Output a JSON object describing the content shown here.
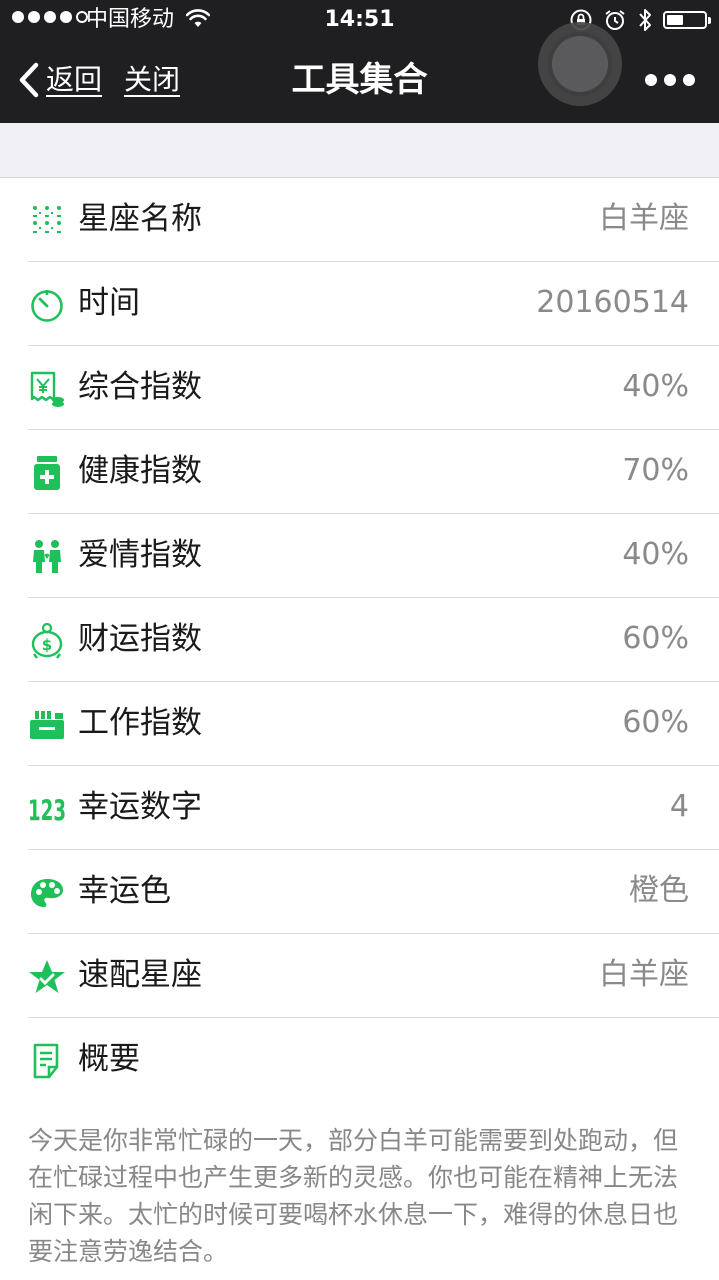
{
  "status_bar": {
    "carrier": "中国移动",
    "time": "14:51",
    "signal_bars_filled": 4,
    "signal_bars_total": 5,
    "battery_level": 0.45,
    "icons": [
      "wifi-icon",
      "orientation-lock-icon",
      "alarm-icon",
      "bluetooth-icon",
      "battery-icon"
    ]
  },
  "nav": {
    "back_label": "返回",
    "close_label": "关闭",
    "title": "工具集合",
    "more_icon": "more-icon"
  },
  "accent_color": "#1fbf5a",
  "rows": [
    {
      "key": "constellation",
      "icon": "zodiac-grid-icon",
      "label": "星座名称",
      "value": "白羊座"
    },
    {
      "key": "time",
      "icon": "timer-icon",
      "label": "时间",
      "value": "20160514"
    },
    {
      "key": "overall",
      "icon": "receipt-icon",
      "label": "综合指数",
      "value": "40%"
    },
    {
      "key": "health",
      "icon": "medicine-icon",
      "label": "健康指数",
      "value": "70%"
    },
    {
      "key": "love",
      "icon": "couple-icon",
      "label": "爱情指数",
      "value": "40%"
    },
    {
      "key": "wealth",
      "icon": "money-bag-icon",
      "label": "财运指数",
      "value": "60%"
    },
    {
      "key": "work",
      "icon": "cash-register-icon",
      "label": "工作指数",
      "value": "60%"
    },
    {
      "key": "lucky_number",
      "icon": "number-123-icon",
      "label": "幸运数字",
      "value": "4"
    },
    {
      "key": "lucky_color",
      "icon": "palette-icon",
      "label": "幸运色",
      "value": "橙色"
    },
    {
      "key": "match",
      "icon": "star-icon",
      "label": "速配星座",
      "value": "白羊座"
    },
    {
      "key": "summary",
      "icon": "note-icon",
      "label": "概要",
      "value": ""
    }
  ],
  "summary_text": "今天是你非常忙碌的一天，部分白羊可能需要到处跑动，但在忙碌过程中也产生更多新的灵感。你也可能在精神上无法闲下来。太忙的时候可要喝杯水休息一下，难得的休息日也要注意劳逸结合。"
}
